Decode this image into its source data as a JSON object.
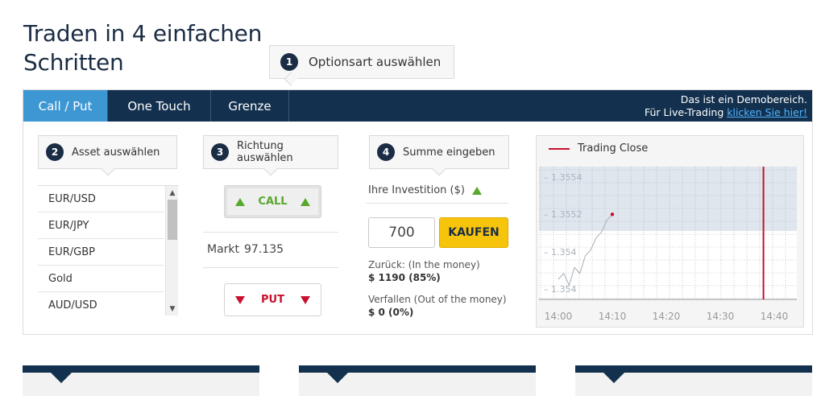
{
  "title_line1": "Traden in 4 einfachen",
  "title_line2": "Schritten",
  "step1": {
    "num": "1",
    "label": "Optionsart auswählen"
  },
  "tabs": [
    {
      "label": "Call / Put",
      "active": true
    },
    {
      "label": "One Touch",
      "active": false
    },
    {
      "label": "Grenze",
      "active": false
    }
  ],
  "demo": {
    "line1": "Das ist ein Demobereich.",
    "line2_prefix": "Für Live-Trading ",
    "link": "klicken Sie hier!"
  },
  "step2": {
    "num": "2",
    "label": "Asset auswählen"
  },
  "step3": {
    "num": "3",
    "label": "Richtung auswählen"
  },
  "step4": {
    "num": "4",
    "label": "Summe eingeben"
  },
  "assets": [
    "EUR/USD",
    "EUR/JPY",
    "EUR/GBP",
    "Gold",
    "AUD/USD"
  ],
  "direction": {
    "call": "CALL",
    "put": "PUT",
    "market_label": "Markt",
    "market_value": "97.135"
  },
  "investment": {
    "label": "Ihre Investition ($)",
    "amount": "700",
    "buy": "KAUFEN",
    "return_label": "Zurück: (In the money)",
    "return_value": "$ 1190 (85%)",
    "expire_label": "Verfallen (Out of the money)",
    "expire_value": "$ 0 (0%)"
  },
  "chart_data": {
    "type": "line",
    "legend": [
      "Trading Close"
    ],
    "x_ticks": [
      "14:00",
      "14:10",
      "14:20",
      "14:30",
      "14:40"
    ],
    "y_ticks": [
      "1.3554",
      "1.3552",
      "1.354",
      "1.354"
    ],
    "series": [
      {
        "name": "",
        "x": [
          "14:00",
          "14:01",
          "14:02",
          "14:03",
          "14:04",
          "14:05",
          "14:06",
          "14:07",
          "14:08",
          "14:09",
          "14:10"
        ],
        "values": [
          1.3538,
          1.3539,
          1.3537,
          1.354,
          1.3539,
          1.3542,
          1.3543,
          1.3545,
          1.3546,
          1.3548,
          1.3549
        ]
      }
    ],
    "closing_time": "14:38",
    "grid": true,
    "colors": {
      "line": "#ffffff",
      "close_line": "#c8102e",
      "shade": "#dfe6ee"
    }
  }
}
